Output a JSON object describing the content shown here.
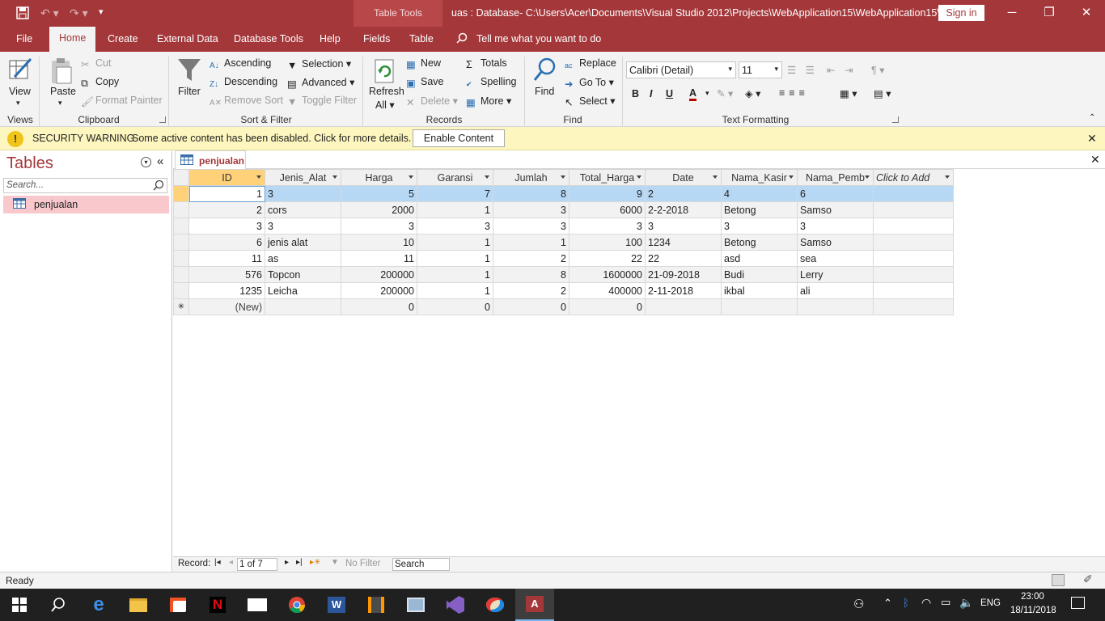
{
  "window": {
    "context_tab_label": "Table Tools",
    "title": "uas : Database- C:\\Users\\Acer\\Documents\\Visual Studio 2012\\Projects\\WebApplication15\\WebApplication15\\...",
    "sign_in": "Sign in"
  },
  "tabs": [
    "File",
    "Home",
    "Create",
    "External Data",
    "Database Tools",
    "Help",
    "Fields",
    "Table"
  ],
  "tell_me": "Tell me what you want to do",
  "ribbon": {
    "views": {
      "view": "View",
      "group": "Views"
    },
    "clipboard": {
      "paste": "Paste",
      "cut": "Cut",
      "copy": "Copy",
      "format_painter": "Format Painter",
      "group": "Clipboard"
    },
    "sort_filter": {
      "filter": "Filter",
      "ascending": "Ascending",
      "descending": "Descending",
      "remove_sort": "Remove Sort",
      "selection": "Selection",
      "advanced": "Advanced",
      "toggle_filter": "Toggle Filter",
      "group": "Sort & Filter"
    },
    "records": {
      "refresh": "Refresh",
      "refresh_all": "All",
      "new": "New",
      "save": "Save",
      "delete": "Delete",
      "totals": "Totals",
      "spelling": "Spelling",
      "more": "More",
      "group": "Records"
    },
    "find": {
      "find": "Find",
      "replace": "Replace",
      "goto": "Go To",
      "select": "Select",
      "group": "Find"
    },
    "text_formatting": {
      "font": "Calibri (Detail)",
      "size": "11",
      "bold": "B",
      "italic": "I",
      "underline": "U",
      "group": "Text Formatting"
    }
  },
  "security": {
    "label": "SECURITY WARNING",
    "message": "Some active content has been disabled. Click for more details.",
    "button": "Enable Content"
  },
  "nav": {
    "title": "Tables",
    "search_placeholder": "Search...",
    "items": [
      {
        "label": "penjualan"
      }
    ]
  },
  "doc_tab": "penjualan",
  "columns": [
    "ID",
    "Jenis_Alat",
    "Harga",
    "Garansi",
    "Jumlah",
    "Total_Harga",
    "Date",
    "Nama_Kasir",
    "Nama_Pemb",
    "Click to Add"
  ],
  "rows": [
    [
      "1",
      "3",
      "5",
      "7",
      "8",
      "9",
      "2",
      "4",
      "6"
    ],
    [
      "2",
      "cors",
      "2000",
      "1",
      "3",
      "6000",
      "2-2-2018",
      "Betong",
      "Samso"
    ],
    [
      "3",
      "3",
      "3",
      "3",
      "3",
      "3",
      "3",
      "3",
      "3"
    ],
    [
      "6",
      "jenis alat",
      "10",
      "1",
      "1",
      "100",
      "1234",
      "Betong",
      "Samso"
    ],
    [
      "11",
      "as",
      "11",
      "1",
      "2",
      "22",
      "22",
      "asd",
      "sea"
    ],
    [
      "576",
      "Topcon",
      "200000",
      "1",
      "8",
      "1600000",
      "21-09-2018",
      "Budi",
      "Lerry"
    ],
    [
      "1235",
      "Leicha",
      "200000",
      "1",
      "2",
      "400000",
      "2-11-2018",
      "ikbal",
      "ali"
    ]
  ],
  "new_row": [
    "(New)",
    "",
    "0",
    "0",
    "0",
    "0",
    "",
    "",
    ""
  ],
  "record_nav": {
    "label": "Record:",
    "position": "1 of 7",
    "filter": "No Filter",
    "search": "Search"
  },
  "status": "Ready",
  "taskbar": {
    "language": "ENG",
    "time": "23:00",
    "date": "18/11/2018"
  },
  "colors": {
    "accent": "#a4373a",
    "selection": "#b7d8f5",
    "warning_bg": "#fdf6bf"
  }
}
